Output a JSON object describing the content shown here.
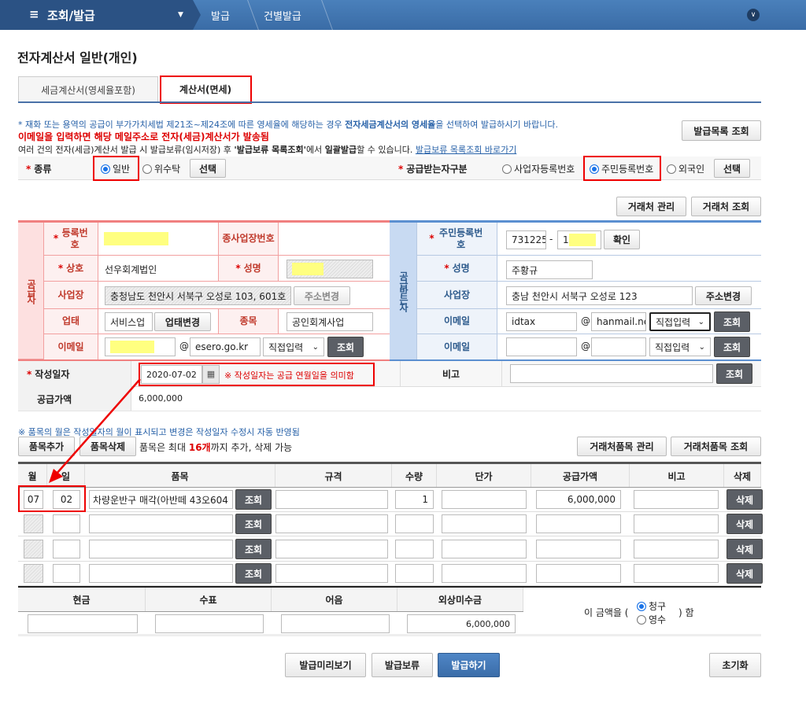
{
  "topbar": {
    "menu": "조회/발급",
    "crumbs": [
      "발급",
      "건별발급"
    ]
  },
  "page_title": "전자계산서 일반(개인)",
  "tabs": [
    "세금계산서(영세율포함)",
    "계산서(면세)"
  ],
  "notes": {
    "line1_a": "* 재화 또는 용역의 공급이 부가가치세법 제21조~제24조에 따른 영세율에 해당하는 경우 ",
    "line1_b": "전자세금계산서의 영세율",
    "line1_c": "을 선택하여 발급하시기 바랍니다.",
    "line2": "이메일을 입력하면 해당 메일주소로 전자(세금)계산서가 발송됨",
    "line3_a": "여러 건의 전자(세금)계산서 발급 시 발급보류(임시저장) 후 ",
    "line3_b": "'발급보류 목록조회'",
    "line3_c": "에서 ",
    "line3_d": "일괄발급",
    "line3_e": "할 수 있습니다. ",
    "line3_link": "발급보류 목록조회 바로가기"
  },
  "buttons": {
    "issue_list": "발급목록 조회",
    "select": "선택",
    "partner_manage": "거래처 관리",
    "partner_search": "거래처 조회",
    "addr_change": "주소변경",
    "biz_change": "업태변경",
    "search": "조회",
    "confirm": "확인",
    "item_add": "품목추가",
    "item_del": "품목삭제",
    "item_partner_manage": "거래처품목 관리",
    "item_partner_search": "거래처품목 조회",
    "delete": "삭제",
    "preview": "발급미리보기",
    "hold": "발급보류",
    "issue": "발급하기",
    "reset": "초기화"
  },
  "kind": {
    "label": "종류",
    "options": [
      "일반",
      "위수탁"
    ],
    "selected": "일반"
  },
  "receiver_type": {
    "label": "공급받는자구분",
    "options": [
      "사업자등록번호",
      "주민등록번호",
      "외국인"
    ],
    "selected": "주민등록번호"
  },
  "supplier": {
    "side_label": "공급자",
    "reg_no_label": "등록번호",
    "sub_biz_label": "종사업장번호",
    "company_label": "상호",
    "company": "선우회계법인",
    "name_label": "성명",
    "address_label": "사업장",
    "address": "충청남도 천안시 서북구 오성로 103, 601호",
    "biz_type_label": "업태",
    "biz_type": "서비스업",
    "biz_item_label": "종목",
    "biz_item": "공인회계사업",
    "email_label": "이메일",
    "email_domain": "esero.go.kr",
    "email_select": "직접입력"
  },
  "receiver": {
    "side_label": "공급받는자",
    "rrn_label": "주민등록번호",
    "rrn_front": "731225",
    "rrn_back": "1",
    "name_label": "성명",
    "name": "주황규",
    "address_label": "사업장",
    "address": "충남 천안시 서북구 오성로 123",
    "email_label": "이메일",
    "email_id": "idtax",
    "email_domain": "hanmail.ne",
    "email_select": "직접입력",
    "email2_label": "이메일",
    "email2_select": "직접입력"
  },
  "write_date": {
    "label": "작성일자",
    "value": "2020-07-02",
    "note": "※ 작성일자는 공급 연월일을 의미함"
  },
  "remark_label": "비고",
  "supply_amount": {
    "label": "공급가액",
    "value": "6,000,000"
  },
  "items_note": "※ 품목의 월은 작성일자의 월이 표시되고 변경은 작성일자 수정시 자동 반영됨",
  "items_limit": {
    "a": "품목은 최대 ",
    "b": "16개",
    "c": "까지 추가, 삭제 가능"
  },
  "items_table": {
    "headers": [
      "월",
      "일",
      "품목",
      "규격",
      "수량",
      "단가",
      "공급가액",
      "비고",
      "삭제"
    ],
    "rows": [
      {
        "month": "07",
        "day": "02",
        "item": "차량운반구 매각(아반떼 43오604",
        "qty": "1",
        "amount": "6,000,000"
      },
      {
        "month": "",
        "day": "",
        "item": "",
        "qty": "",
        "amount": ""
      },
      {
        "month": "",
        "day": "",
        "item": "",
        "qty": "",
        "amount": ""
      },
      {
        "month": "",
        "day": "",
        "item": "",
        "qty": "",
        "amount": ""
      }
    ]
  },
  "payment": {
    "headers": [
      "현금",
      "수표",
      "어음",
      "외상미수금"
    ],
    "values": [
      "",
      "",
      "",
      "6,000,000"
    ],
    "phrase_a": "이 금액을 (",
    "phrase_b": ") 함",
    "options": [
      "청구",
      "영수"
    ],
    "selected": "청구"
  }
}
